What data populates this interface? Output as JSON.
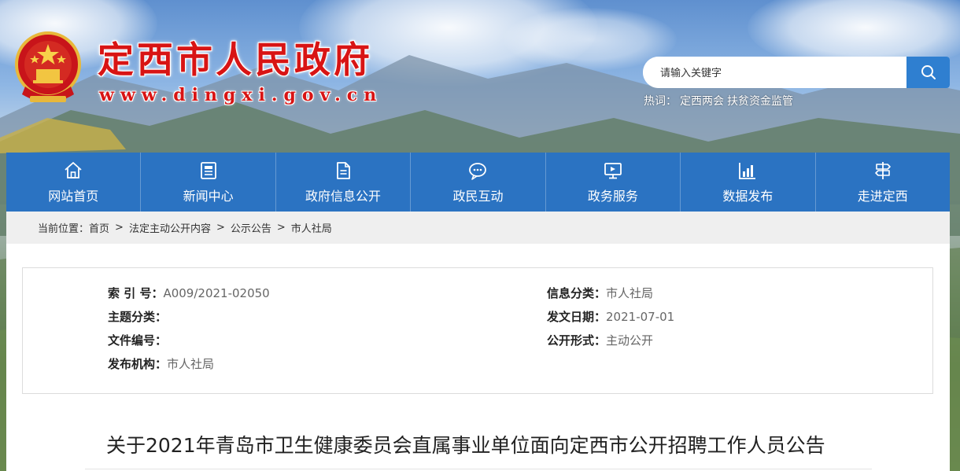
{
  "site": {
    "title": "定西市人民政府",
    "url": "www.dingxi.gov.cn"
  },
  "search": {
    "placeholder": "请输入关键字",
    "hot_label": "热词：",
    "hot_words": [
      "定西两会",
      "扶贫资金监管"
    ]
  },
  "nav": {
    "items": [
      {
        "label": "网站首页",
        "icon": "home-icon"
      },
      {
        "label": "新闻中心",
        "icon": "news-icon"
      },
      {
        "label": "政府信息公开",
        "icon": "document-icon"
      },
      {
        "label": "政民互动",
        "icon": "chat-icon"
      },
      {
        "label": "政务服务",
        "icon": "monitor-icon"
      },
      {
        "label": "数据发布",
        "icon": "chart-icon"
      },
      {
        "label": "走进定西",
        "icon": "signpost-icon"
      }
    ]
  },
  "breadcrumb": {
    "prefix": "当前位置：",
    "items": [
      "首页",
      "法定主动公开内容",
      "公示公告",
      "市人社局"
    ],
    "separator": ">"
  },
  "meta": {
    "index_label": "索 引 号：",
    "index_value": "A009/2021-02050",
    "category_label": "信息分类：",
    "category_value": "市人社局",
    "topic_label": "主题分类：",
    "topic_value": "",
    "date_label": "发文日期：",
    "date_value": "2021-07-01",
    "docno_label": "文件编号：",
    "docno_value": "",
    "form_label": "公开形式：",
    "form_value": "主动公开",
    "issuer_label": "发布机构：",
    "issuer_value": "市人社局"
  },
  "document": {
    "title": "关于2021年青岛市卫生健康委员会直属事业单位面向定西市公开招聘工作人员公告"
  },
  "colors": {
    "brand_red": "#d81414",
    "nav_blue": "#2b73c2",
    "search_blue": "#2f7fd0"
  }
}
